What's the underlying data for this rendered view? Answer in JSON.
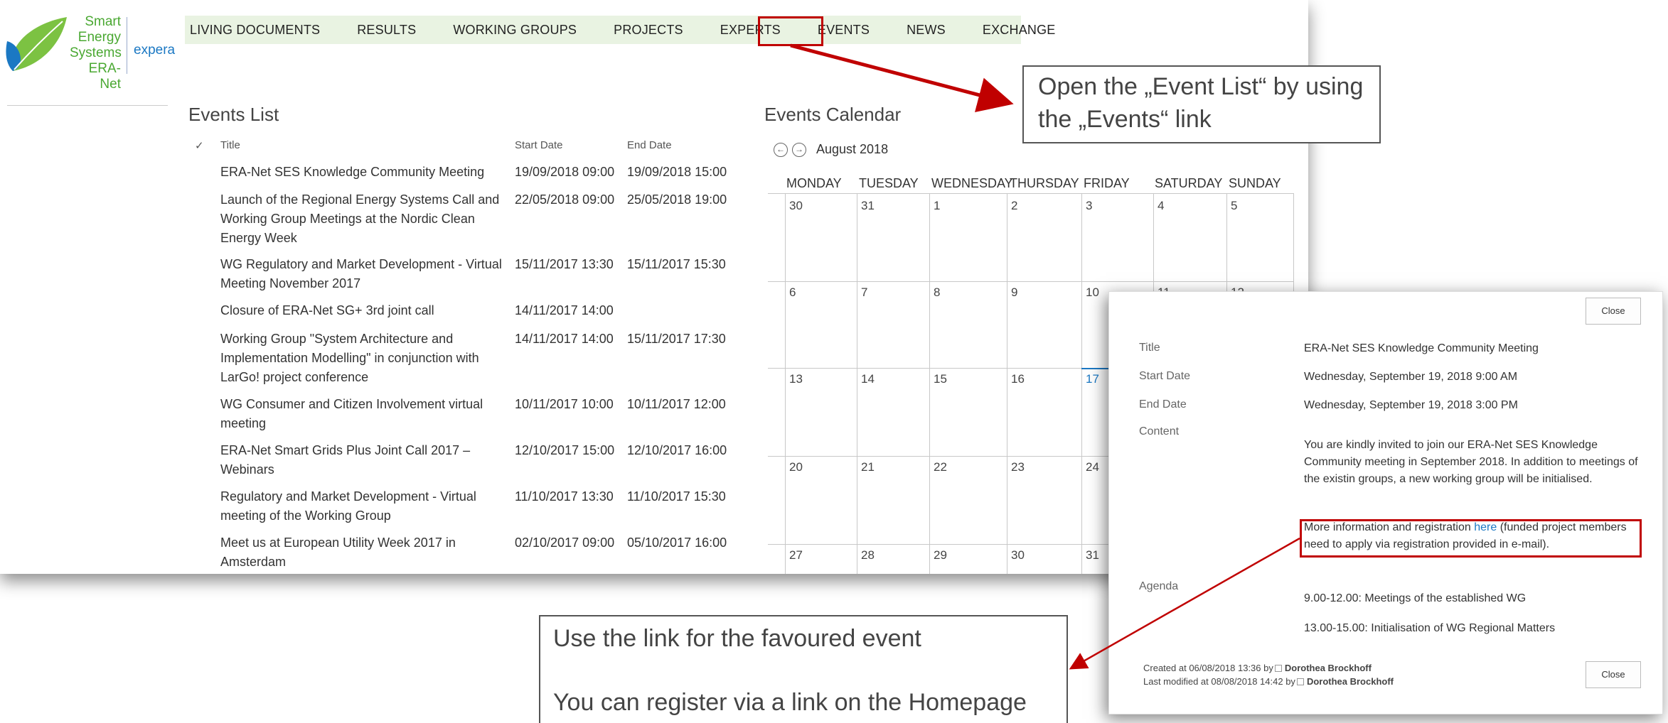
{
  "logo": {
    "line1": "Smart",
    "line2": "Energy",
    "line3": "Systems",
    "line4": "ERA-Net",
    "partner": "expera"
  },
  "nav": {
    "items": [
      "LIVING DOCUMENTS",
      "RESULTS",
      "WORKING GROUPS",
      "PROJECTS",
      "EXPERTS",
      "EVENTS",
      "NEWS",
      "EXCHANGE"
    ],
    "active": "EVENTS"
  },
  "events_list": {
    "title": "Events List",
    "columns": {
      "check": "✓",
      "title": "Title",
      "start": "Start Date",
      "end": "End Date"
    },
    "rows": [
      {
        "title": "ERA-Net SES Knowledge Community Meeting",
        "start": "19/09/2018 09:00",
        "end": "19/09/2018 15:00"
      },
      {
        "title": "Launch of the Regional Energy Systems Call and Working Group Meetings at the Nordic Clean Energy Week",
        "start": "22/05/2018 09:00",
        "end": "25/05/2018 19:00"
      },
      {
        "title": "WG Regulatory and Market Development - Virtual Meeting November 2017",
        "start": "15/11/2017 13:30",
        "end": "15/11/2017 15:30"
      },
      {
        "title": "Closure of ERA-Net SG+ 3rd joint call",
        "start": "14/11/2017 14:00",
        "end": ""
      },
      {
        "title": "Working Group \"System Architecture and Implementation Modelling\" in conjunction with LarGo! project conference",
        "start": "14/11/2017 14:00",
        "end": "15/11/2017 17:30"
      },
      {
        "title": "WG Consumer and Citizen Involvement virtual meeting",
        "start": "10/11/2017 10:00",
        "end": "10/11/2017 12:00"
      },
      {
        "title": "ERA-Net Smart Grids Plus Joint Call 2017 – Webinars",
        "start": "12/10/2017 15:00",
        "end": "12/10/2017 16:00"
      },
      {
        "title": "Regulatory and Market Development - Virtual meeting of the Working Group",
        "start": "11/10/2017 13:30",
        "end": "11/10/2017 15:30"
      },
      {
        "title": "Meet us at European Utility Week 2017 in Amsterdam",
        "start": "02/10/2017 09:00",
        "end": "05/10/2017 16:00"
      }
    ]
  },
  "calendar": {
    "title": "Events Calendar",
    "month": "August 2018",
    "prev_icon": "←",
    "next_icon": "→",
    "weekdays": [
      "MONDAY",
      "TUESDAY",
      "WEDNESDAY",
      "THURSDAY",
      "FRIDAY",
      "SATURDAY",
      "SUNDAY"
    ],
    "weeks": [
      [
        "30",
        "31",
        "1",
        "2",
        "3",
        "4",
        "5"
      ],
      [
        "6",
        "7",
        "8",
        "9",
        "10",
        "11",
        "12"
      ],
      [
        "13",
        "14",
        "15",
        "16",
        "17",
        "",
        ""
      ],
      [
        "20",
        "21",
        "22",
        "23",
        "24",
        "",
        ""
      ],
      [
        "27",
        "28",
        "29",
        "30",
        "31",
        "",
        ""
      ]
    ],
    "today": "17"
  },
  "dialog": {
    "close_label": "Close",
    "labels": {
      "title": "Title",
      "start": "Start Date",
      "end": "End Date",
      "content": "Content",
      "agenda": "Agenda"
    },
    "title": "ERA-Net SES Knowledge Community Meeting",
    "start": "Wednesday, September 19, 2018 9:00 AM",
    "end": "Wednesday, September 19, 2018 3:00 PM",
    "content_p1": "You are kindly invited to join our ERA-Net SES Knowledge Community meeting in September 2018. In addition to meetings of the existin groups, a new working group will be initialised.",
    "content_p2_before": "More information and registration ",
    "content_p2_link": "here",
    "content_p2_after": " (funded project members need to apply via registration provided in e-mail).",
    "agenda_1": "9.00-12.00: Meetings of the established WG",
    "agenda_2": "13.00-15.00: Initialisation of WG Regional Matters",
    "created": "Created at 06/08/2018 13:36 by",
    "modified": "Last modified at 08/08/2018 14:42 by",
    "author": "Dorothea Brockhoff"
  },
  "callouts": {
    "top": "Open the „Event List“ by using the „Events“ link",
    "bottom_1": "Use the link for the favoured event",
    "bottom_2": "You can register via a link on the Homepage"
  },
  "colors": {
    "nav_bg": "#e9f3e2",
    "highlight_red": "#c00000",
    "link_blue": "#1b78c3",
    "logo_green": "#4aa832"
  }
}
